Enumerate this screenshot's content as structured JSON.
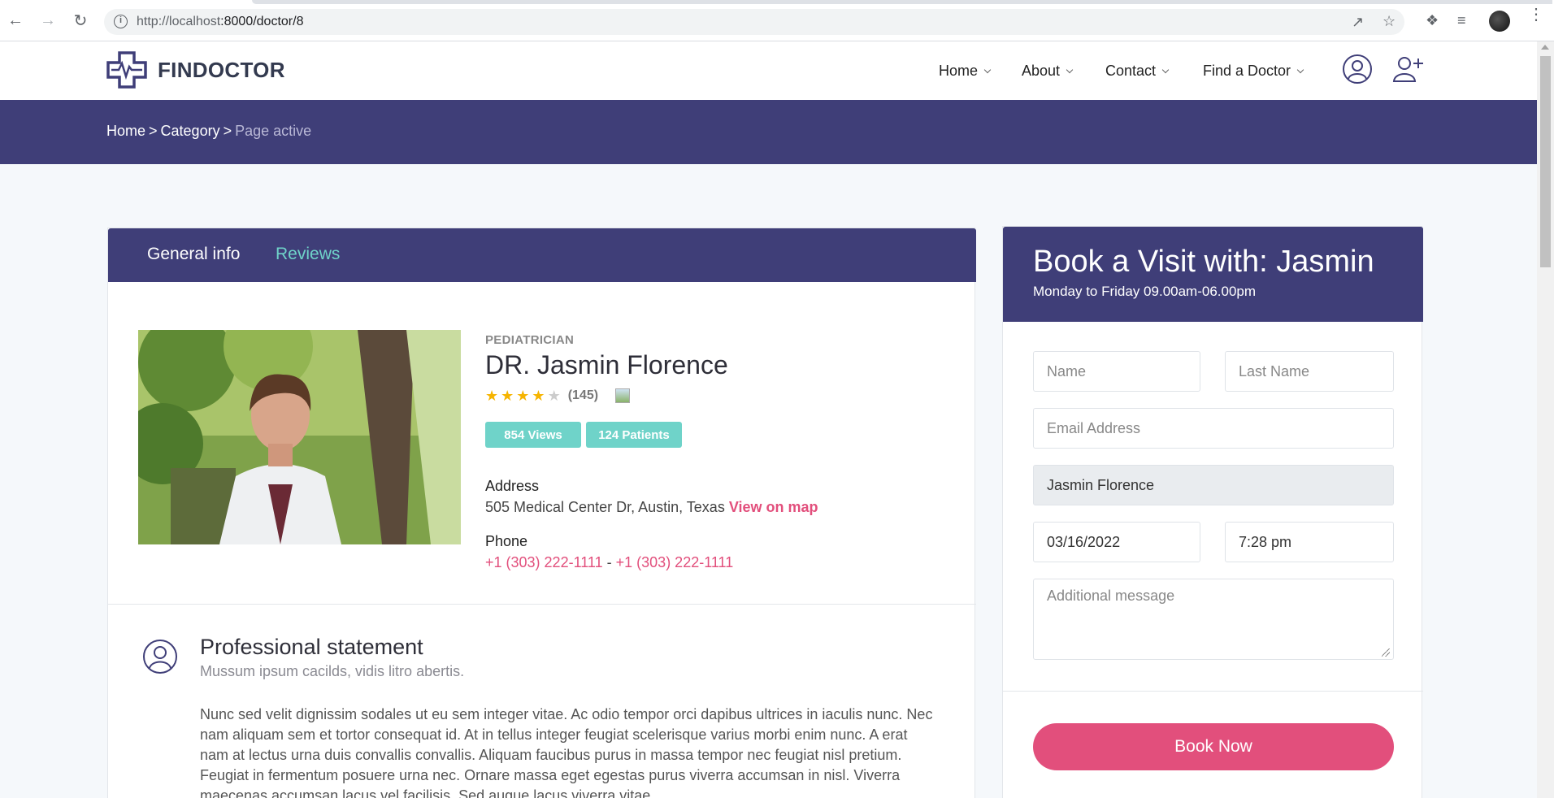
{
  "browser": {
    "url_host": "http://localhost",
    "url_path": ":8000/doctor/8"
  },
  "site": {
    "logo_text": "FINDOCTOR",
    "menu": [
      {
        "label": "Home"
      },
      {
        "label": "About"
      },
      {
        "label": "Contact"
      },
      {
        "label": "Find a Doctor"
      }
    ]
  },
  "breadcrumb": {
    "home": "Home",
    "category": "Category",
    "active": "Page active",
    "separator": ">"
  },
  "tabs": {
    "general": "General info",
    "reviews": "Reviews"
  },
  "doctor": {
    "specialty": "PEDIATRICIAN",
    "name": "DR. Jasmin Florence",
    "rating": 4,
    "rating_max": 5,
    "rating_count": "(145)",
    "views_badge": "854 Views",
    "patients_badge": "124 Patients",
    "address_label": "Address",
    "address": "505 Medical Center Dr, Austin, Texas",
    "view_map": "View on map",
    "phone_label": "Phone",
    "phone1": "+1 (303) 222-1111",
    "phone_sep": "-",
    "phone2": "+1 (303) 222-1111"
  },
  "statement": {
    "title": "Professional statement",
    "subtitle": "Mussum ipsum cacilds, vidis litro abertis.",
    "body": "Nunc sed velit dignissim sodales ut eu sem integer vitae. Ac odio tempor orci dapibus ultrices in iaculis nunc. Nec nam aliquam sem et tortor consequat id. At in tellus integer feugiat scelerisque varius morbi enim nunc. A erat nam at lectus urna duis convallis convallis. Aliquam faucibus purus in massa tempor nec feugiat nisl pretium. Feugiat in fermentum posuere urna nec. Ornare massa eget egestas purus viverra accumsan in nisl. Viverra maecenas accumsan lacus vel facilisis. Sed augue lacus viverra vitae"
  },
  "booking": {
    "title": "Book a Visit with: Jasmin",
    "hours": "Monday to Friday 09.00am-06.00pm",
    "name_placeholder": "Name",
    "lastname_placeholder": "Last Name",
    "email_placeholder": "Email Address",
    "doctor_value": "Jasmin Florence",
    "date_value": "03/16/2022",
    "time_value": "7:28 pm",
    "message_placeholder": "Additional message",
    "button": "Book Now"
  },
  "colors": {
    "primary": "#3f3e78",
    "accent_teal": "#6fd3c9",
    "accent_pink": "#e24f7c"
  }
}
